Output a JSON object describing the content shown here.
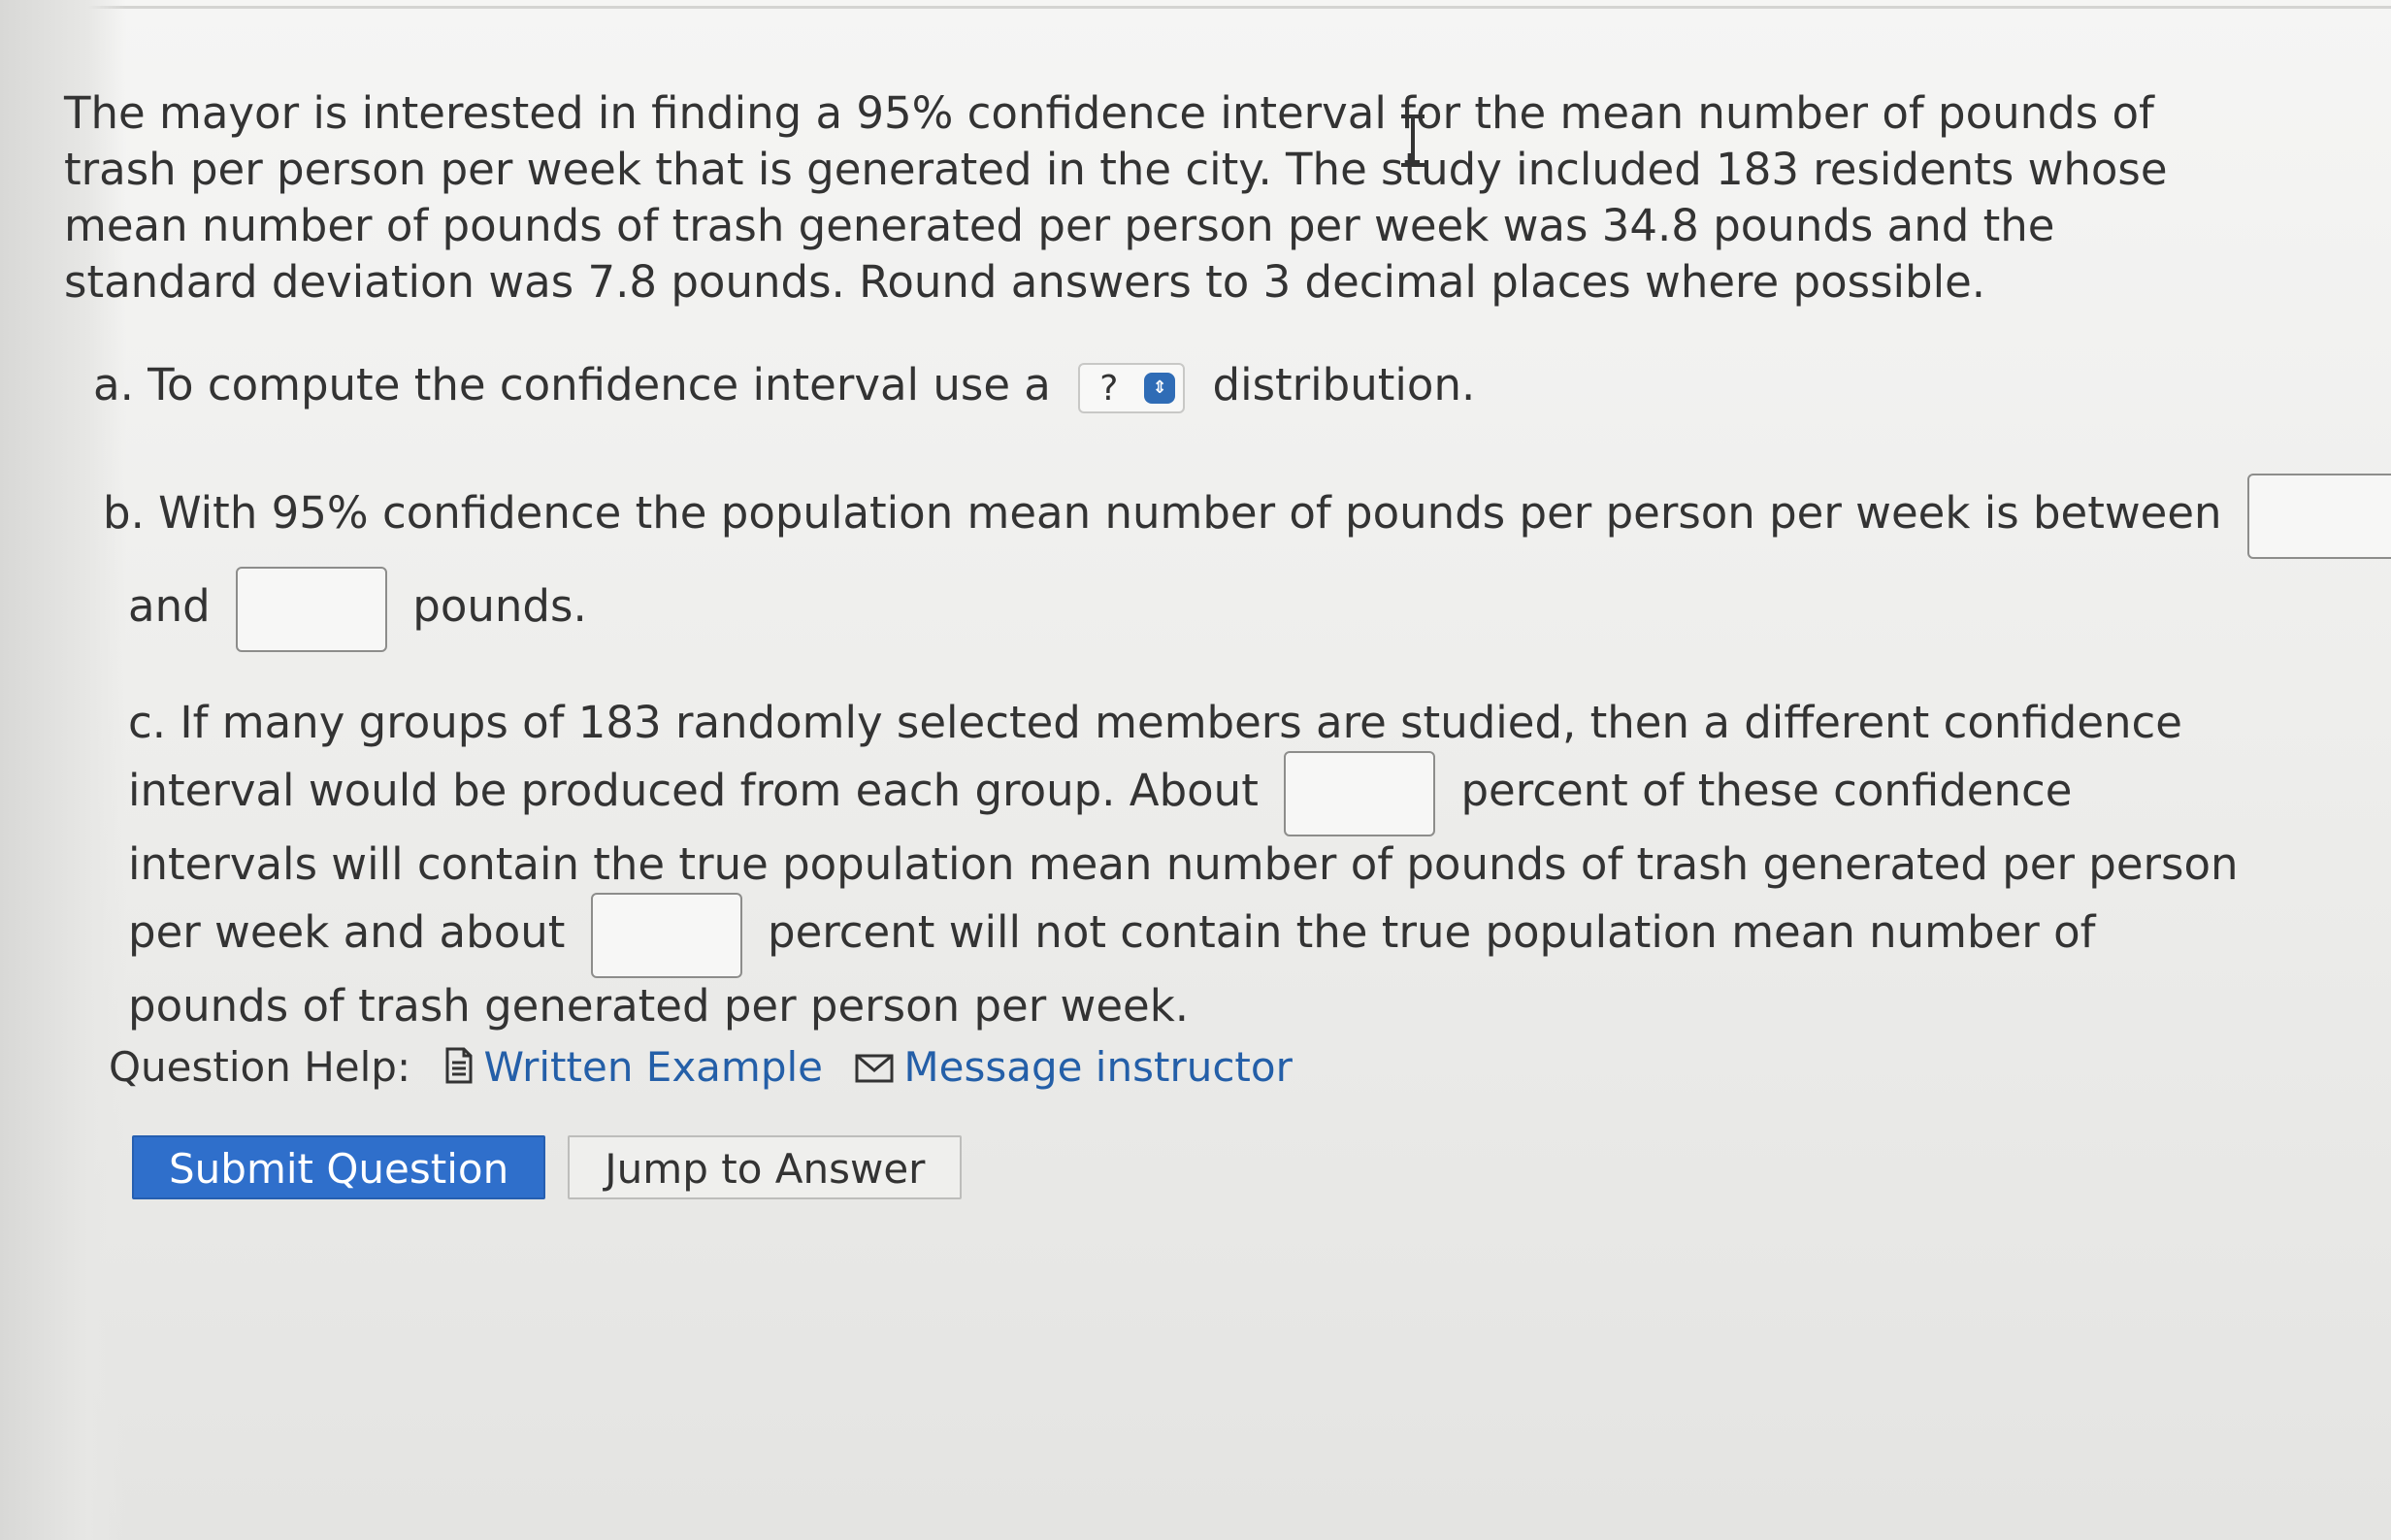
{
  "problem": {
    "intro": "The mayor is interested in finding a 95% confidence interval for the mean number of pounds of trash per person per week that is generated in the city. The study included 183 residents whose mean number of pounds of trash generated per person per week was 34.8 pounds and the standard deviation was 7.8 pounds. Round answers to 3 decimal places where possible.",
    "part_a": {
      "prefix": "a. To compute the confidence interval use a",
      "select_value": "?",
      "suffix": "distribution."
    },
    "part_b": {
      "line1": "b. With 95% confidence the population mean number of pounds per person per week is between",
      "line2_prefix": "and",
      "line2_suffix": "pounds."
    },
    "part_c": {
      "text1": "c. If many groups of 183 randomly selected members are studied, then a different confidence interval would be produced from each group. About",
      "text2": "percent of these confidence intervals will contain the true population mean number of pounds of trash generated per person per week and about",
      "text3": "percent will not contain the true population mean number of pounds of trash generated per person per week."
    }
  },
  "help": {
    "label": "Question Help:",
    "written_example": "Written Example",
    "message_instructor": "Message instructor"
  },
  "buttons": {
    "submit": "Submit Question",
    "jump": "Jump to Answer"
  },
  "colors": {
    "accent": "#2f6fcb",
    "link": "#245fa8"
  }
}
